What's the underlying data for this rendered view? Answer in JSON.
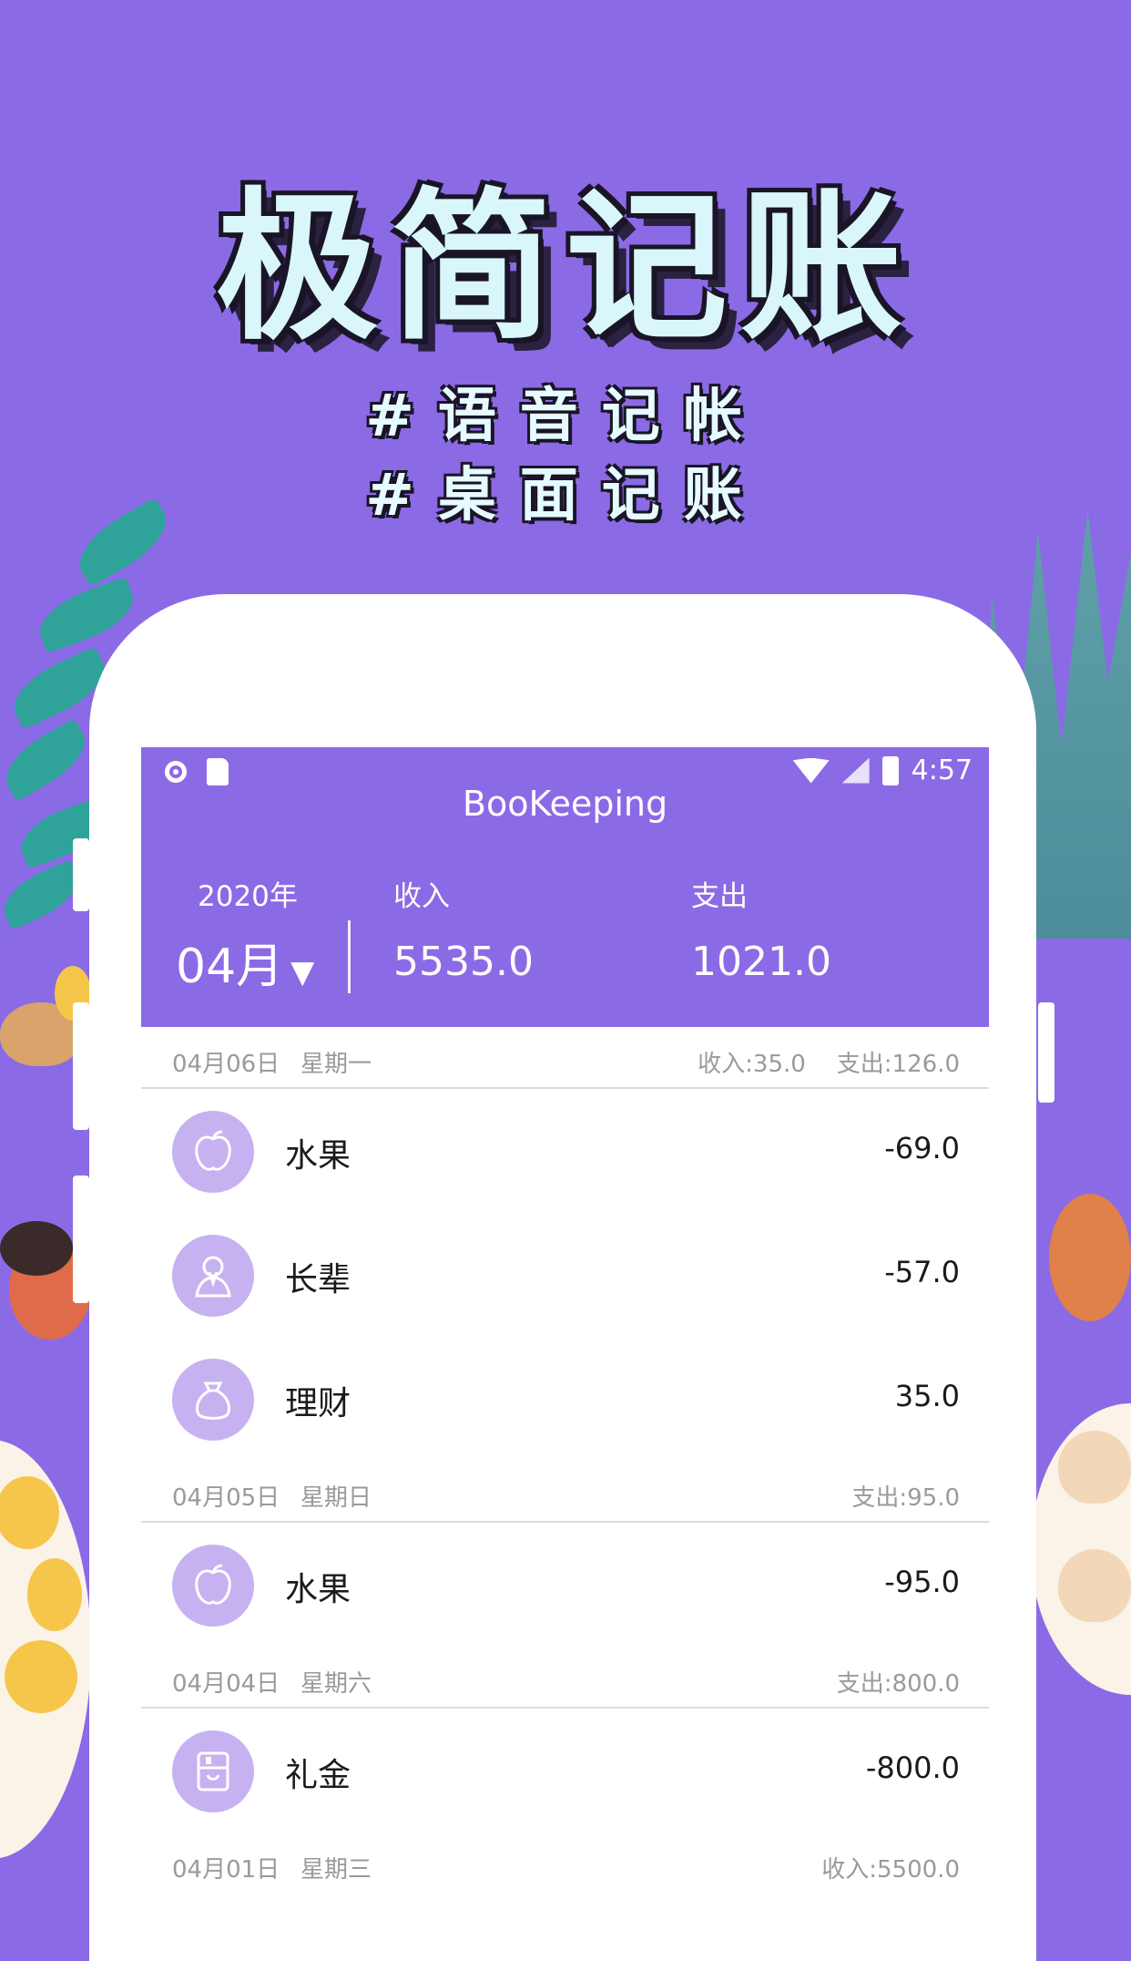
{
  "promo": {
    "title": "极简记账",
    "tag1": "#语音记帐",
    "tag2": "#桌面记账"
  },
  "status_bar": {
    "time": "4:57"
  },
  "app": {
    "title": "BooKeeping",
    "year": "2020年",
    "month": "04月",
    "month_caret": "▼",
    "income_label": "收入",
    "income_value": "5535.0",
    "expense_label": "支出",
    "expense_value": "1021.0"
  },
  "days": [
    {
      "date": "04月06日",
      "weekday": "星期一",
      "income": "收入:35.0",
      "expense": "支出:126.0",
      "items": [
        {
          "icon": "fruit-icon",
          "name": "水果",
          "amount": "-69.0"
        },
        {
          "icon": "elder-icon",
          "name": "长辈",
          "amount": "-57.0"
        },
        {
          "icon": "money-bag-icon",
          "name": "理财",
          "amount": "35.0"
        }
      ]
    },
    {
      "date": "04月05日",
      "weekday": "星期日",
      "expense": "支出:95.0",
      "items": [
        {
          "icon": "fruit-icon",
          "name": "水果",
          "amount": "-95.0"
        }
      ]
    },
    {
      "date": "04月04日",
      "weekday": "星期六",
      "expense": "支出:800.0",
      "items": [
        {
          "icon": "gift-money-icon",
          "name": "礼金",
          "amount": "-800.0"
        }
      ]
    },
    {
      "date": "04月01日",
      "weekday": "星期三",
      "income": "收入:5500.0",
      "items": []
    }
  ],
  "colors": {
    "accent": "#8b6ae6",
    "icon_bg": "#c6b2f1"
  }
}
